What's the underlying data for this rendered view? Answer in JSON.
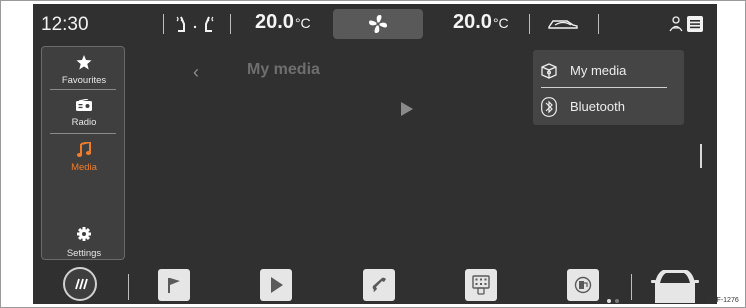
{
  "status_bar": {
    "time": "12:30",
    "left_temp": {
      "value": "20.0",
      "unit": "°C"
    },
    "right_temp": {
      "value": "20.0",
      "unit": "°C"
    }
  },
  "sidebar": {
    "items": [
      {
        "label": "Favourites",
        "icon": "star-icon",
        "active": false
      },
      {
        "label": "Radio",
        "icon": "radio-icon",
        "active": false
      },
      {
        "label": "Media",
        "icon": "music-note-icon",
        "active": true
      },
      {
        "label": "Settings",
        "icon": "gear-icon",
        "active": false
      }
    ]
  },
  "main": {
    "title": "My media"
  },
  "dropdown": {
    "items": [
      {
        "label": "My media",
        "icon": "media-box-icon"
      },
      {
        "label": "Bluetooth",
        "icon": "bluetooth-icon"
      }
    ]
  },
  "dock": {
    "items": [
      "home-icon",
      "flag-icon",
      "play-icon",
      "phone-icon",
      "keypad-phone-icon",
      "fuel-icon",
      "car-icon"
    ]
  },
  "footer_code": "B5F-1276",
  "colors": {
    "screen_bg": "#303030",
    "accent": "#f07d2c",
    "panel": "#454545"
  }
}
